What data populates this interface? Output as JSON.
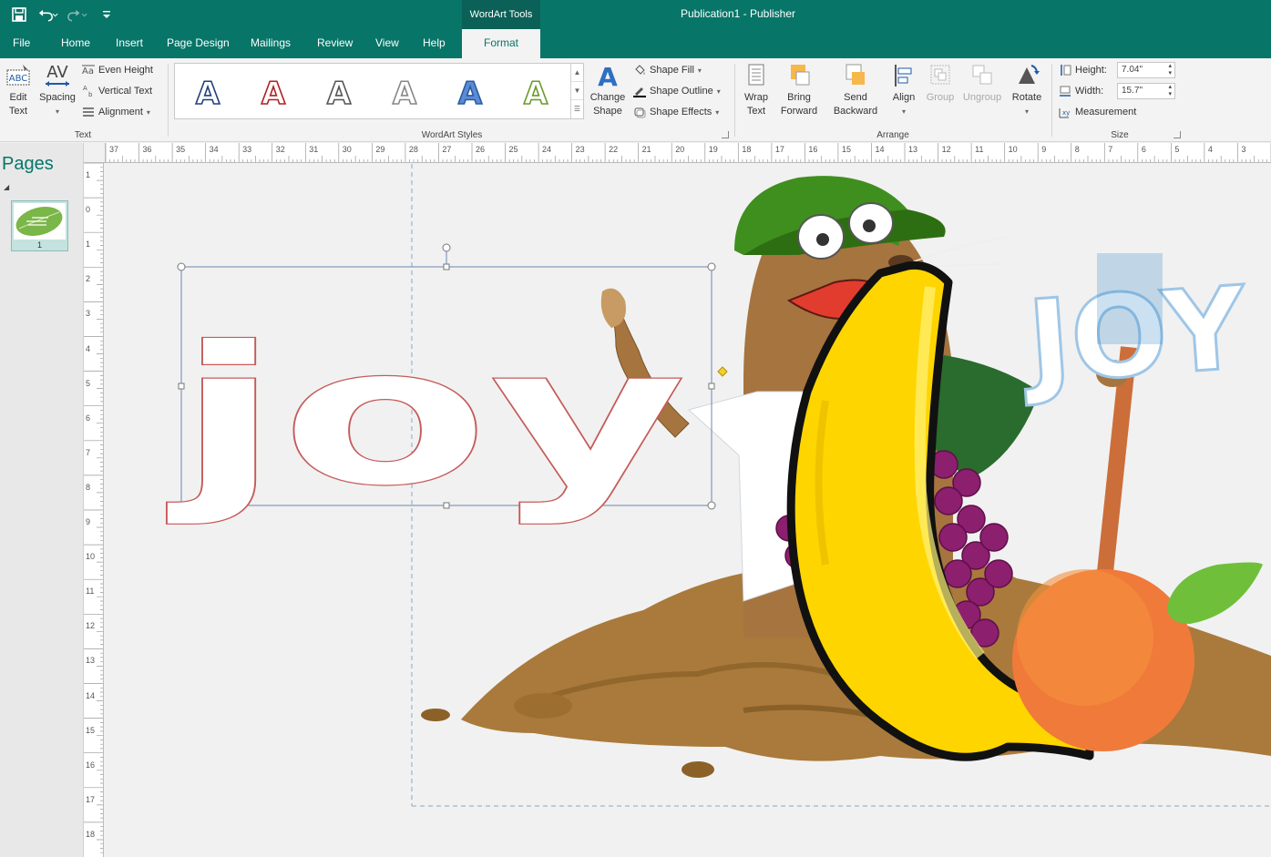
{
  "titlebar": {
    "context_tools": "WordArt Tools",
    "document_title": "Publication1  -  Publisher"
  },
  "tabs": [
    {
      "label": "File"
    },
    {
      "label": "Home"
    },
    {
      "label": "Insert"
    },
    {
      "label": "Page Design"
    },
    {
      "label": "Mailings"
    },
    {
      "label": "Review"
    },
    {
      "label": "View"
    },
    {
      "label": "Help"
    },
    {
      "label": "Format",
      "active": true
    }
  ],
  "ribbon": {
    "text_group": {
      "label": "Text",
      "edit_text": "Edit Text",
      "spacing": "Spacing",
      "even_height": "Even Height",
      "vertical_text": "Vertical Text",
      "alignment": "Alignment"
    },
    "wordart_styles": {
      "label": "WordArt Styles",
      "samples": [
        {
          "glyph": "A",
          "fill": "#ffffff",
          "stroke": "#1f3f7a"
        },
        {
          "glyph": "A",
          "fill": "#ffffff",
          "stroke": "#b02020"
        },
        {
          "glyph": "A",
          "fill": "#ffffff",
          "stroke": "#555555"
        },
        {
          "glyph": "A",
          "fill": "#ffffff",
          "stroke": "#888888"
        },
        {
          "glyph": "A",
          "fill": "#5a8bd6",
          "stroke": "#2c5aa0"
        },
        {
          "glyph": "A",
          "fill": "#ffffff",
          "stroke": "#6a9a2a"
        }
      ],
      "change_shape": "Change Shape",
      "shape_fill": "Shape Fill",
      "shape_outline": "Shape Outline",
      "shape_effects": "Shape Effects"
    },
    "arrange": {
      "label": "Arrange",
      "wrap_text": "Wrap Text",
      "bring_forward": "Bring Forward",
      "send_backward": "Send Backward",
      "align": "Align",
      "group": "Group",
      "ungroup": "Ungroup",
      "rotate": "Rotate"
    },
    "size": {
      "label": "Size",
      "height_label": "Height:",
      "height_value": "7.04\"",
      "width_label": "Width:",
      "width_value": "15.7\"",
      "measurement": "Measurement"
    }
  },
  "pages": {
    "title": "Pages",
    "items": [
      {
        "number": "1"
      }
    ]
  },
  "rulers": {
    "horizontal": [
      "37",
      "36",
      "35",
      "34",
      "33",
      "32",
      "31",
      "30",
      "29",
      "28",
      "27",
      "26",
      "25",
      "24",
      "23",
      "22",
      "21",
      "20",
      "19",
      "18",
      "17",
      "16",
      "15",
      "14",
      "13",
      "12",
      "11",
      "10",
      "9",
      "8",
      "7",
      "6",
      "5",
      "4",
      "3"
    ],
    "vertical": [
      "1",
      "0",
      "1",
      "2",
      "3",
      "4",
      "5",
      "6",
      "7",
      "8",
      "9",
      "10",
      "11",
      "12",
      "13",
      "14",
      "15",
      "16",
      "17",
      "18"
    ]
  },
  "canvas": {
    "wordart_text": "joy",
    "sign_text": "JOY"
  },
  "colors": {
    "brand": "#077568",
    "context_tab": "#0b6157"
  }
}
